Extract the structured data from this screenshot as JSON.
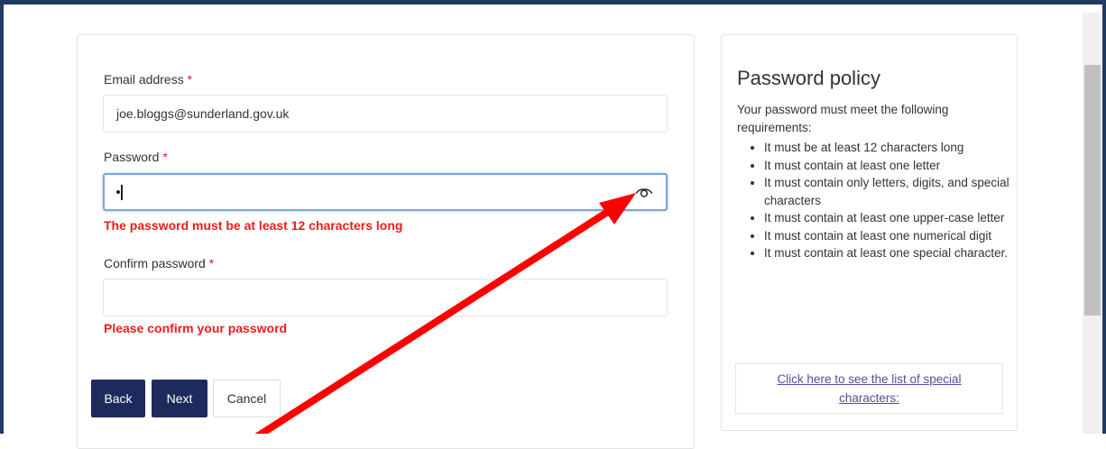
{
  "form": {
    "email": {
      "label": "Email address",
      "required_marker": "*",
      "value": "joe.bloggs@sunderland.gov.uk"
    },
    "password": {
      "label": "Password",
      "required_marker": "*",
      "value_masked": "•",
      "error": "The password must be at least 12 characters long",
      "toggle_icon": "eye-icon"
    },
    "confirm_password": {
      "label": "Confirm password",
      "required_marker": "*",
      "value": "",
      "error": "Please confirm your password"
    },
    "buttons": {
      "back": "Back",
      "next": "Next",
      "cancel": "Cancel"
    }
  },
  "policy": {
    "title": "Password policy",
    "intro": "Your password must meet the following requirements:",
    "rules": [
      "It must be at least 12 characters long",
      "It must contain at least one letter",
      "It must contain only letters, digits, and special characters",
      "It must contain at least one upper-case letter",
      "It must contain at least one numerical digit",
      "It must contain at least one special character."
    ],
    "special_chars_link": "Click here to see the list of special characters:"
  },
  "colors": {
    "frame": "#1f3a63",
    "primary_button": "#1f2a5c",
    "error": "#ee1c1c",
    "required": "#d9232d",
    "link": "#5b4a9a",
    "annotation_arrow": "#ff0000"
  }
}
